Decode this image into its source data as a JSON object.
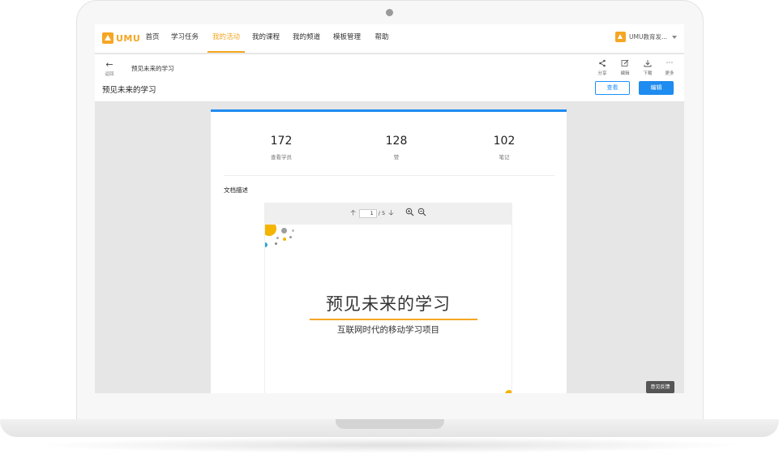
{
  "nav": {
    "logo_text": "UMU",
    "items": [
      {
        "label": "首页"
      },
      {
        "label": "学习任务"
      },
      {
        "label": "我的活动"
      },
      {
        "label": "我的课程"
      },
      {
        "label": "我的频道"
      },
      {
        "label": "模板管理"
      },
      {
        "label": "帮助"
      }
    ],
    "active_item": "我的活动",
    "org_name": "UMU教育发..."
  },
  "subheader": {
    "back_label": "返回",
    "breadcrumb": "预见未来的学习",
    "title": "预见未来的学习",
    "tools": [
      {
        "icon": "share-icon",
        "label": "分享"
      },
      {
        "icon": "edit-icon",
        "label": "编辑"
      },
      {
        "icon": "download-icon",
        "label": "下载"
      },
      {
        "icon": "more-icon",
        "label": "更多"
      }
    ],
    "view_button": "查看",
    "edit_button": "编辑"
  },
  "stats": [
    {
      "value": "172",
      "label": "查看学员"
    },
    {
      "value": "128",
      "label": "赞"
    },
    {
      "value": "102",
      "label": "笔记"
    }
  ],
  "document": {
    "section_label": "文档描述",
    "current_page": "1",
    "total_pages": "/ 5",
    "slide_title": "预见未来的学习",
    "slide_subtitle": "互联网时代的移动学习项目"
  },
  "feedback_button": "意见反馈",
  "colors": {
    "brand": "#f5a623",
    "primary": "#1e8cf0"
  }
}
